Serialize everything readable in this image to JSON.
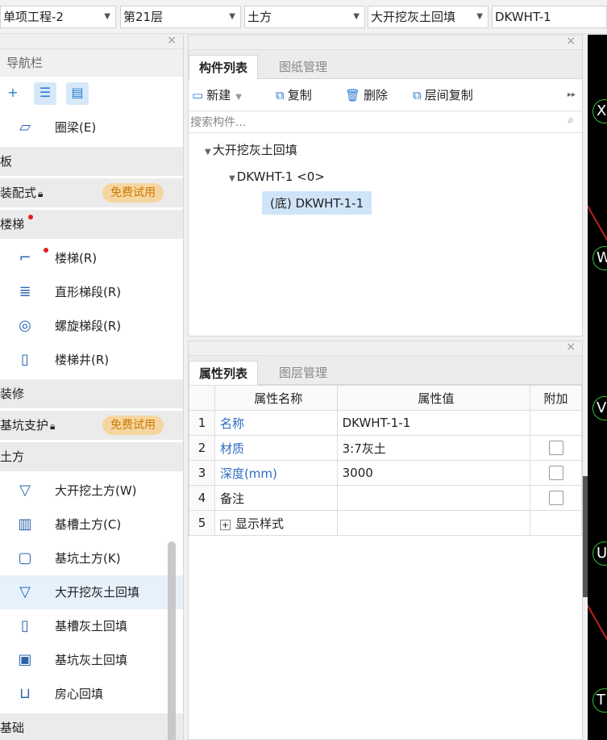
{
  "toolbar": {
    "project": "单项工程-2",
    "floor": "第21层",
    "category": "土方",
    "component_type": "大开挖灰土回填",
    "component": "DKWHT-1"
  },
  "nav": {
    "title": "导航栏",
    "items_top": [
      {
        "label": "圈梁(E)",
        "icon": "ring-beam-icon"
      }
    ],
    "group_slab": "板",
    "group_prefab": "装配式",
    "trial_label": "免费试用",
    "group_stairs": "楼梯",
    "stairs_items": [
      {
        "label": "楼梯(R)",
        "icon": "stairs-icon"
      },
      {
        "label": "直形梯段(R)",
        "icon": "straight-flight-icon"
      },
      {
        "label": "螺旋梯段(R)",
        "icon": "spiral-flight-icon"
      },
      {
        "label": "楼梯井(R)",
        "icon": "stairwell-icon"
      }
    ],
    "group_decor": "装修",
    "group_pit": "基坑支护",
    "trial_label2": "免费试用",
    "group_earth": "土方",
    "earth_items": [
      {
        "label": "大开挖土方(W)",
        "icon": "open-excavation-icon"
      },
      {
        "label": "基槽土方(C)",
        "icon": "trench-icon"
      },
      {
        "label": "基坑土方(K)",
        "icon": "pit-icon"
      },
      {
        "label": "大开挖灰土回填",
        "icon": "open-backfill-icon"
      },
      {
        "label": "基槽灰土回填",
        "icon": "trench-backfill-icon"
      },
      {
        "label": "基坑灰土回填",
        "icon": "pit-backfill-icon"
      },
      {
        "label": "房心回填",
        "icon": "room-backfill-icon"
      }
    ],
    "group_foundation": "基础"
  },
  "components": {
    "tabs": [
      "构件列表",
      "图纸管理"
    ],
    "actions": {
      "new": "新建",
      "copy": "复制",
      "delete": "删除",
      "floor_copy": "层间复制"
    },
    "search_placeholder": "搜索构件...",
    "tree_root": "大开挖灰土回填",
    "tree_child": "DKWHT-1 <0>",
    "tree_leaf": "(底) DKWHT-1-1"
  },
  "properties": {
    "tabs": [
      "属性列表",
      "图层管理"
    ],
    "headers": {
      "name": "属性名称",
      "value": "属性值",
      "extra": "附加"
    },
    "rows": [
      {
        "num": "1",
        "name": "名称",
        "value": "DKWHT-1-1"
      },
      {
        "num": "2",
        "name": "材质",
        "value": "3:7灰土"
      },
      {
        "num": "3",
        "name": "深度(mm)",
        "value": "3000"
      },
      {
        "num": "4",
        "name": "备注",
        "value": ""
      },
      {
        "num": "5",
        "name": "显示样式",
        "value": ""
      }
    ]
  },
  "canvas": {
    "axes": [
      "X",
      "W",
      "V",
      "U",
      "T"
    ]
  }
}
